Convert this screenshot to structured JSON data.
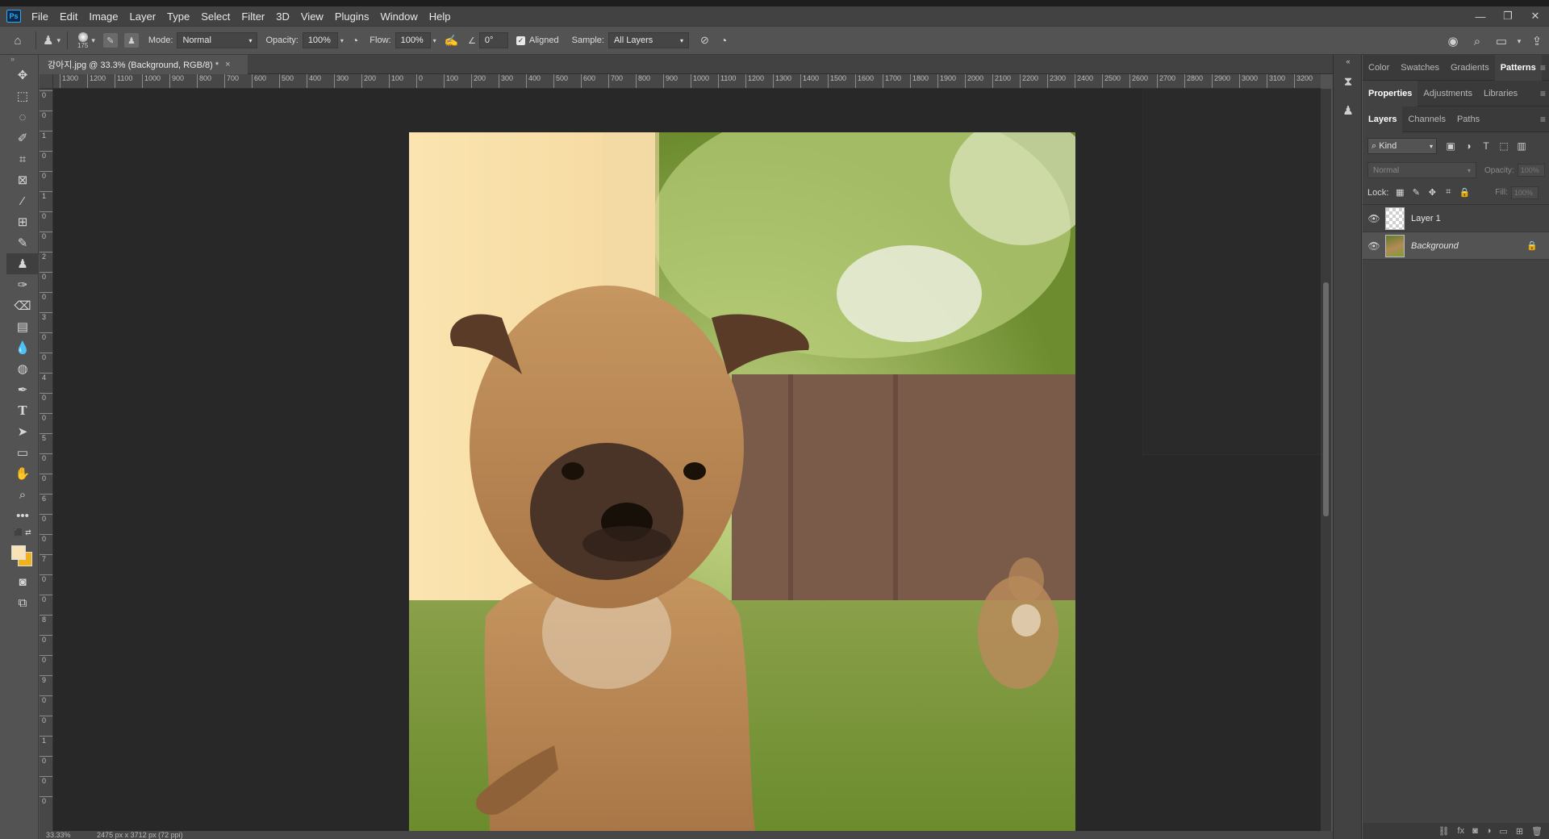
{
  "app": {
    "logo": "Ps"
  },
  "menu": [
    "File",
    "Edit",
    "Image",
    "Layer",
    "Type",
    "Select",
    "Filter",
    "3D",
    "View",
    "Plugins",
    "Window",
    "Help"
  ],
  "window_controls": {
    "minimize": "—",
    "restore": "❐",
    "close": "✕"
  },
  "options": {
    "brush_size": "175",
    "mode_label": "Mode:",
    "mode_value": "Normal",
    "opacity_label": "Opacity:",
    "opacity_value": "100%",
    "flow_label": "Flow:",
    "flow_value": "100%",
    "angle_value": "0°",
    "aligned_label": "Aligned",
    "sample_label": "Sample:",
    "sample_value": "All Layers"
  },
  "document": {
    "tab_title": "강아지.jpg @ 33.3% (Background, RGB/8) *",
    "close": "×"
  },
  "ruler_h": [
    "1300",
    "1200",
    "1100",
    "1000",
    "900",
    "800",
    "700",
    "600",
    "500",
    "400",
    "300",
    "200",
    "100",
    "0",
    "100",
    "200",
    "300",
    "400",
    "500",
    "600",
    "700",
    "800",
    "900",
    "1000",
    "1100",
    "1200",
    "1300",
    "1400",
    "1500",
    "1600",
    "1700",
    "1800",
    "1900",
    "2000",
    "2100",
    "2200",
    "2300",
    "2400",
    "2500",
    "2600",
    "2700",
    "2800",
    "2900",
    "3000",
    "3100",
    "3200",
    "3300"
  ],
  "ruler_v": [
    "0",
    "0",
    "1",
    "0",
    "0",
    "1",
    "0",
    "0",
    "2",
    "0",
    "0",
    "3",
    "0",
    "0",
    "4",
    "0",
    "0",
    "5",
    "0",
    "0",
    "6",
    "0",
    "0",
    "7",
    "0",
    "0",
    "8",
    "0",
    "0",
    "9",
    "0",
    "0",
    "1",
    "0",
    "0",
    "0"
  ],
  "status": {
    "zoom": "33.33%",
    "dims": "2475 px x 3712 px (72 ppi)"
  },
  "panels": {
    "top_tabs": [
      "Color",
      "Swatches",
      "Gradients",
      "Patterns"
    ],
    "top_active": "Patterns",
    "mid_tabs": [
      "Properties",
      "Adjustments",
      "Libraries"
    ],
    "mid_active": "Properties",
    "layer_tabs": [
      "Layers",
      "Channels",
      "Paths"
    ],
    "layer_active": "Layers",
    "kind_label": "Kind",
    "blend_mode": "Normal",
    "opacity_label": "Opacity:",
    "opacity_value": "100%",
    "lock_label": "Lock:",
    "fill_label": "Fill:",
    "fill_value": "100%"
  },
  "layers": [
    {
      "name": "Layer 1",
      "selected": false,
      "locked": false
    },
    {
      "name": "Background",
      "selected": true,
      "locked": true
    }
  ],
  "colors": {
    "foreground": "#f7e3b3",
    "background": "#f0b21a",
    "accent": "#31a8ff"
  }
}
